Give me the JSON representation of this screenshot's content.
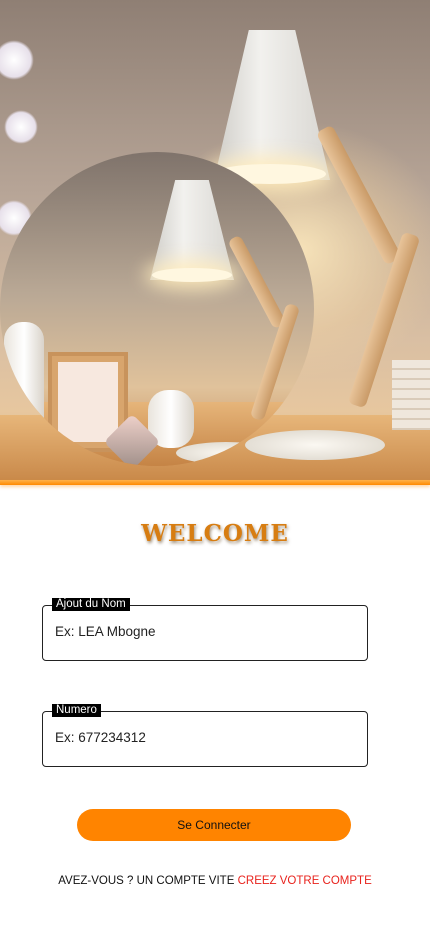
{
  "hero": {
    "image": "desk-lamp-photo",
    "accent_color": "#ff8a00"
  },
  "welcome": {
    "title": "WELCOME",
    "color": "#d77d12"
  },
  "form": {
    "name_field": {
      "label": "Ajout du Nom",
      "placeholder": "Ex: LEA Mbogne"
    },
    "number_field": {
      "label": "Numero",
      "placeholder": "Ex: 677234312"
    },
    "submit_label": "Se Connecter",
    "submit_color": "#ff8400"
  },
  "footer": {
    "question": "AVEZ-VOUS ? UN COMPTE VITE",
    "link_label": "CREEZ VOTRE COMPTE",
    "link_color": "#e8231d"
  }
}
